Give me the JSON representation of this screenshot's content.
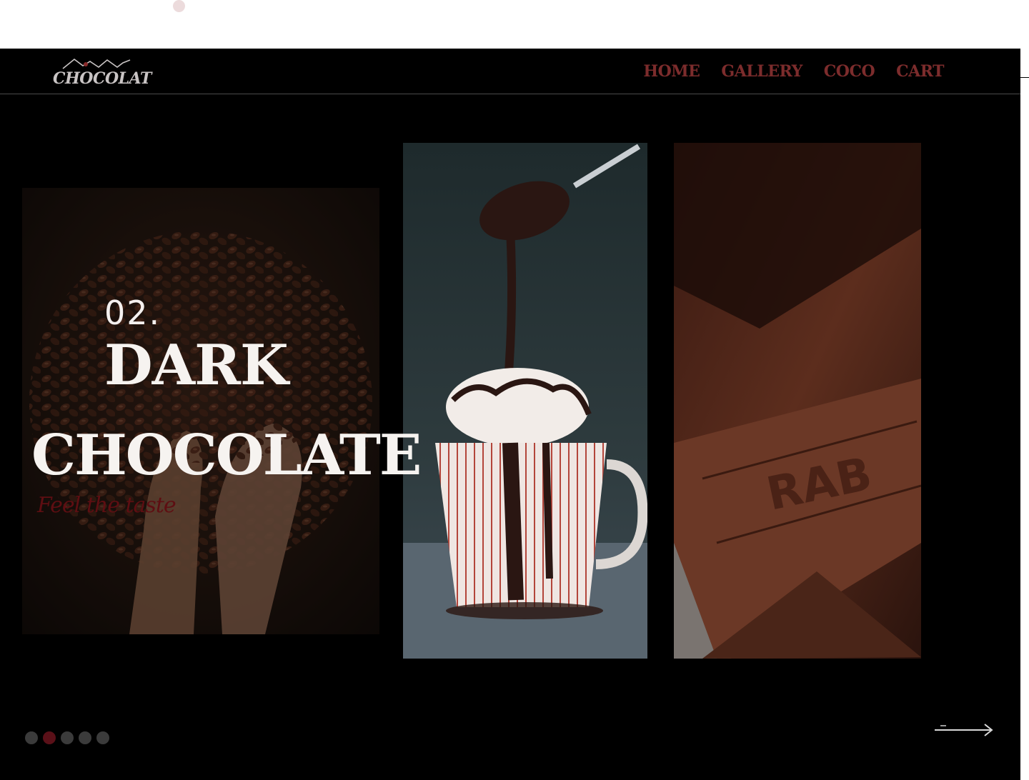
{
  "brand": {
    "logo_text": "CHOCOLAT"
  },
  "nav": {
    "items": [
      {
        "label": "HOME"
      },
      {
        "label": "GALLERY"
      },
      {
        "label": "COCO"
      },
      {
        "label": "CART"
      }
    ]
  },
  "hero": {
    "number": "02.",
    "title_line1": "DARK",
    "title_line2": "CHOCOLATE",
    "tagline": "Feel the taste"
  },
  "slider": {
    "total_slides": 5,
    "active_index": 1,
    "next_icon": "arrow-right-icon"
  },
  "colors": {
    "background": "#000000",
    "nav_link": "#7c2c2c",
    "hero_text": "#f6f3f0",
    "tagline": "#5e0e12",
    "dot_active": "#5a1018",
    "dot_inactive": "#3b3b3b"
  }
}
